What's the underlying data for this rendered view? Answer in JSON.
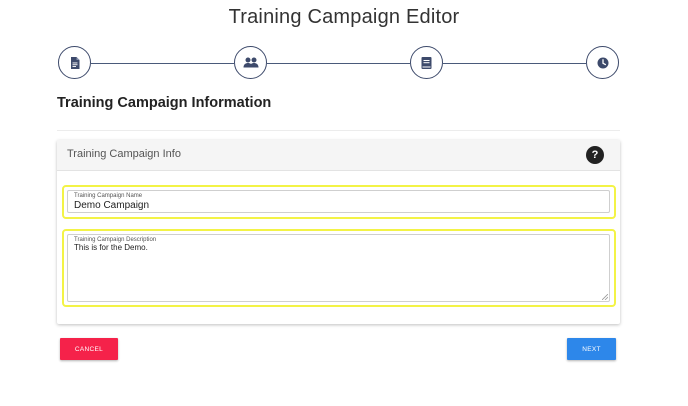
{
  "page": {
    "title": "Training Campaign Editor"
  },
  "stepper": {
    "steps": [
      {
        "icon": "document-icon"
      },
      {
        "icon": "users-icon"
      },
      {
        "icon": "book-icon"
      },
      {
        "icon": "clock-icon"
      }
    ]
  },
  "section": {
    "title": "Training Campaign Information"
  },
  "card": {
    "title": "Training Campaign Info",
    "help_label": "?",
    "fields": {
      "name": {
        "label": "Training Campaign Name",
        "value": "Demo Campaign"
      },
      "description": {
        "label": "Training Campaign Description",
        "value": "This is for the Demo."
      }
    }
  },
  "actions": {
    "cancel_label": "CANCEL",
    "next_label": "NEXT"
  },
  "colors": {
    "step_border": "#3d4a6b",
    "highlight": "#f3f346",
    "cancel": "#f5224a",
    "next": "#2d87ea"
  }
}
